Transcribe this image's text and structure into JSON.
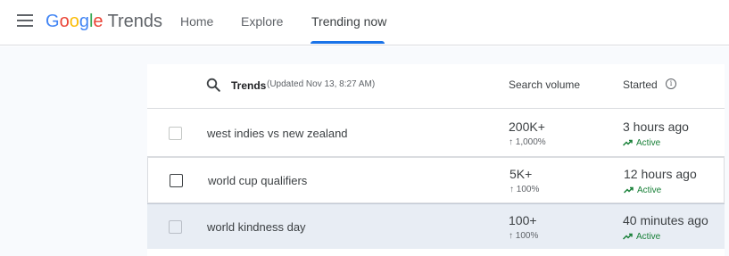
{
  "header": {
    "brand_google": [
      "G",
      "o",
      "o",
      "g",
      "l",
      "e"
    ],
    "brand_product": "Trends",
    "nav": [
      {
        "label": "Home"
      },
      {
        "label": "Explore"
      },
      {
        "label": "Trending now",
        "active": true
      }
    ]
  },
  "table": {
    "columns": {
      "trends": "Trends",
      "updated": "(Updated Nov 13, 8:27 AM)",
      "search_volume": "Search volume",
      "started": "Started"
    },
    "rows": [
      {
        "term": "west indies vs new zealand",
        "volume": "200K+",
        "change": "↑ 1,000%",
        "started": "3 hours ago",
        "status": "Active"
      },
      {
        "term": "world cup qualifiers",
        "volume": "5K+",
        "change": "↑ 100%",
        "started": "12 hours ago",
        "status": "Active"
      },
      {
        "term": "world kindness day",
        "volume": "100+",
        "change": "↑ 100%",
        "started": "40 minutes ago",
        "status": "Active"
      }
    ]
  },
  "icons": {
    "menu": "menu-icon",
    "search": "search-icon",
    "info": "info-icon",
    "trending": "trending-up-icon"
  },
  "colors": {
    "active_tab": "#1a73e8",
    "status_active": "#188038",
    "selected_row": "#e8edf4"
  }
}
